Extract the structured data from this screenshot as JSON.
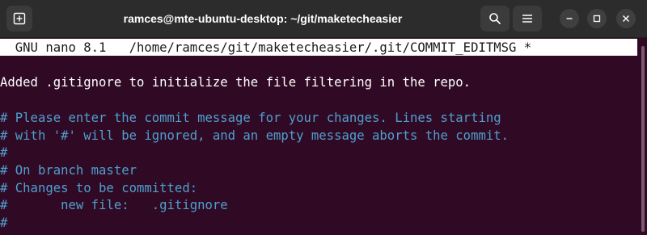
{
  "window": {
    "title": "ramces@mte-ubuntu-desktop: ~/git/maketecheasier"
  },
  "nano": {
    "header": "  GNU nano 8.1   /home/ramces/git/maketecheasier/.git/COMMIT_EDITMSG *",
    "lines": [
      "Added .gitignore to initialize the file filtering in the repo.",
      "",
      "# Please enter the commit message for your changes. Lines starting",
      "# with '#' will be ignored, and an empty message aborts the commit.",
      "#",
      "# On branch master",
      "# Changes to be committed:",
      "#\tnew file:   .gitignore",
      "#"
    ]
  },
  "colors": {
    "terminal_bg": "#300a24",
    "comment": "#4f9fcf",
    "titlebar": "#2c2c2c"
  },
  "icons": {
    "new_tab": "new-tab-icon",
    "search": "search-icon",
    "menu": "hamburger-menu-icon",
    "minimize": "minimize-icon",
    "maximize": "maximize-icon",
    "close": "close-icon"
  }
}
